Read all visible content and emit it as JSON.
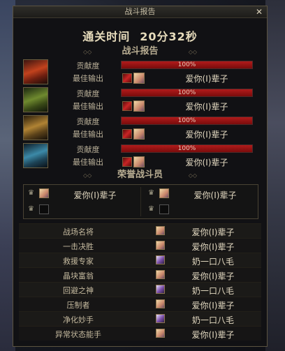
{
  "window": {
    "title": "战斗报告"
  },
  "summary": {
    "time_label": "通关时间",
    "time_value": "20分32秒"
  },
  "report": {
    "header": "战斗报告",
    "contribution_label": "贡献度",
    "best_output_label": "最佳输出",
    "players": [
      {
        "portrait": "red-helmet-portrait",
        "contribution_text": "100%",
        "contribution": 1.0,
        "best_output_name": "爱你(I)辈子"
      },
      {
        "portrait": "green-helmet-portrait",
        "contribution_text": "100%",
        "contribution": 1.0,
        "best_output_name": "爱你(I)辈子"
      },
      {
        "portrait": "gold-helmet-portrait",
        "contribution_text": "100%",
        "contribution": 1.0,
        "best_output_name": "爱你(I)辈子"
      },
      {
        "portrait": "blue-helmet-portrait",
        "contribution_text": "100%",
        "contribution": 1.0,
        "best_output_name": "爱你(I)辈子"
      }
    ]
  },
  "honor": {
    "header": "荣誉战斗员",
    "members": [
      {
        "name": "爱你(I)辈子",
        "filled": true
      },
      {
        "name": "爱你(I)辈子",
        "filled": true
      },
      {
        "name": "",
        "filled": false
      },
      {
        "name": "",
        "filled": false
      }
    ]
  },
  "awards": [
    {
      "title": "战场名将",
      "name": "爱你(I)辈子",
      "icon": "warrior"
    },
    {
      "title": "一击决胜",
      "name": "爱你(I)辈子",
      "icon": "warrior"
    },
    {
      "title": "救援专家",
      "name": "奶一口八毛",
      "icon": "priest"
    },
    {
      "title": "晶块富翁",
      "name": "爱你(I)辈子",
      "icon": "warrior"
    },
    {
      "title": "回避之神",
      "name": "奶一口八毛",
      "icon": "priest"
    },
    {
      "title": "压制者",
      "name": "爱你(I)辈子",
      "icon": "warrior"
    },
    {
      "title": "净化妙手",
      "name": "奶一口八毛",
      "icon": "priest"
    },
    {
      "title": "异常状态能手",
      "name": "爱你(I)辈子",
      "icon": "warrior"
    }
  ]
}
